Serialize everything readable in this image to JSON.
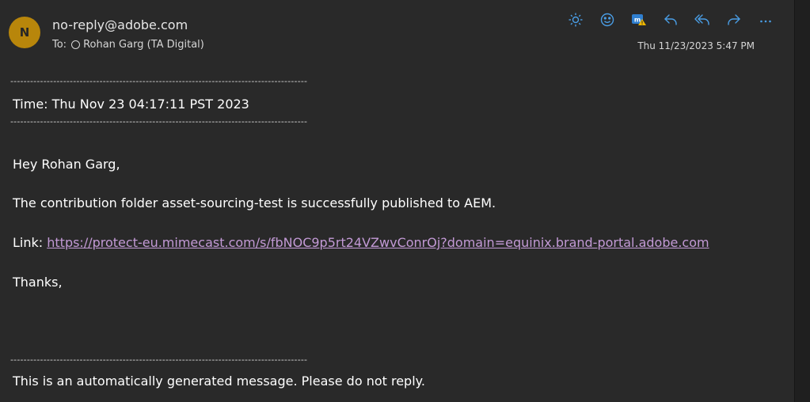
{
  "header": {
    "avatar_initial": "N",
    "avatar_color": "#b8860b",
    "sender": "no-reply@adobe.com",
    "to_label": "To:",
    "recipient": "Rohan Garg (TA Digital)",
    "date": "Thu 11/23/2023 5:47 PM"
  },
  "toolbar": {
    "icons": [
      "brightness-icon",
      "emoji-icon",
      "message-extensions-icon",
      "reply-icon",
      "reply-all-icon",
      "forward-icon",
      "more-icon"
    ],
    "accent_color": "#4a9ee6"
  },
  "message": {
    "rule_top": "------------------------------------------------------------------------------------------",
    "time_line": "Time: Thu Nov 23 04:17:11 PST 2023",
    "rule_mid": "------------------------------------------------------------------------------------------",
    "greeting": "Hey Rohan Garg,",
    "body": "The contribution folder asset-sourcing-test is successfully published to AEM.",
    "link_label": "Link: ",
    "link_url": "https://protect-eu.mimecast.com/s/fbNOC9p5rt24VZwvConrOj?domain=equinix.brand-portal.adobe.com",
    "signoff": "Thanks,",
    "rule_bottom": "------------------------------------------------------------------------------------------",
    "footer": "This is an automatically generated message. Please do not reply."
  }
}
